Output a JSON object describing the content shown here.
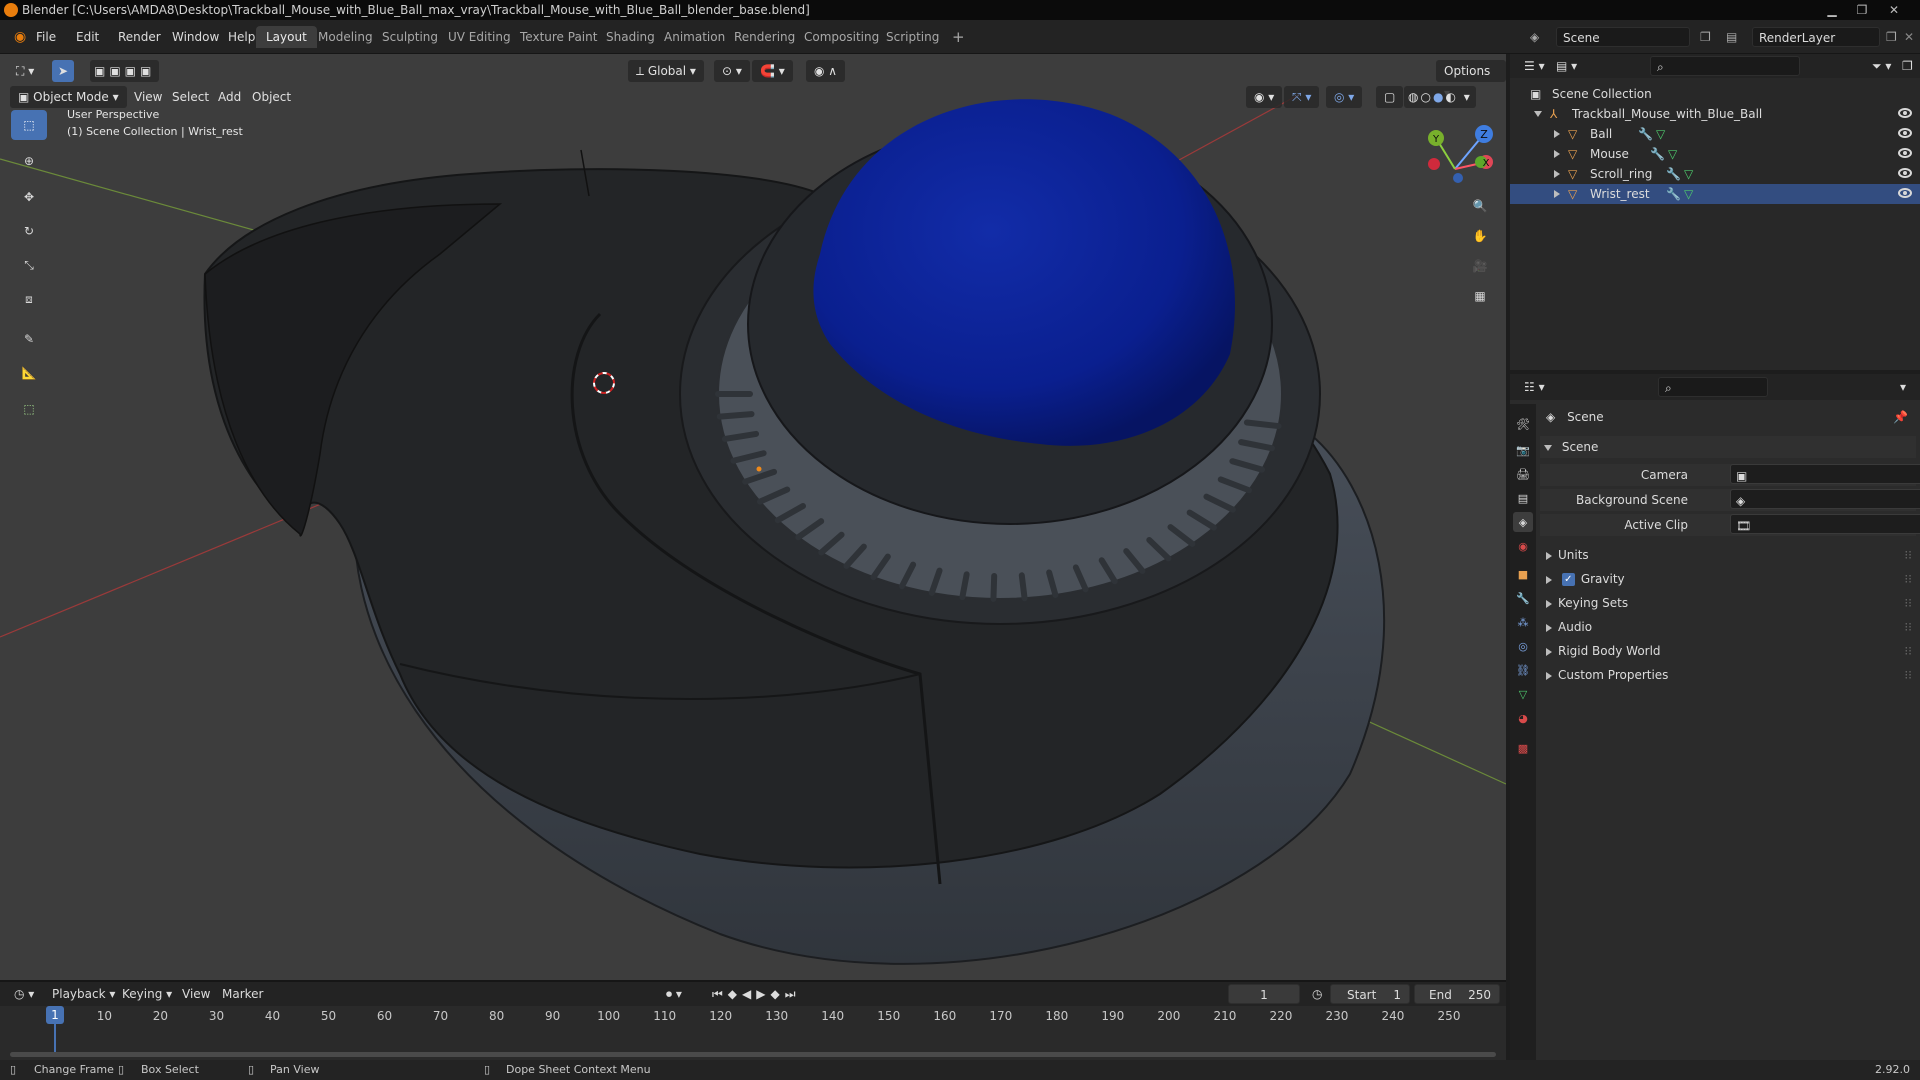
{
  "window": {
    "title": "Blender [C:\\Users\\AMDA8\\Desktop\\Trackball_Mouse_with_Blue_Ball_max_vray\\Trackball_Mouse_with_Blue_Ball_blender_base.blend]"
  },
  "menu": {
    "items": [
      "File",
      "Edit",
      "Render",
      "Window",
      "Help"
    ]
  },
  "workspaces": {
    "tabs": [
      "Layout",
      "Modeling",
      "Sculpting",
      "UV Editing",
      "Texture Paint",
      "Shading",
      "Animation",
      "Rendering",
      "Compositing",
      "Scripting"
    ],
    "active": "Layout"
  },
  "top_right": {
    "scene_field": "Scene",
    "render_layer_field": "RenderLayer"
  },
  "viewport_header": {
    "transform_orientation": "Global",
    "options_label": "Options",
    "mode": "Object Mode",
    "menus": [
      "View",
      "Select",
      "Add",
      "Object"
    ]
  },
  "viewport": {
    "perspective_label": "User Perspective",
    "collection_label": "(1) Scene Collection | Wrist_rest",
    "ball_color": "#0a1f8f",
    "body_color": "#232527",
    "ring_color": "#3a4049",
    "accent_color": "#4772b3",
    "gizmo": {
      "x": "X",
      "y": "Y",
      "z": "Z"
    }
  },
  "timeline": {
    "menus": [
      "Playback",
      "Keying",
      "View",
      "Marker"
    ],
    "current_frame": "1",
    "start_label": "Start",
    "start_value": "1",
    "end_label": "End",
    "end_value": "250",
    "ticks": [
      "1",
      "10",
      "20",
      "30",
      "40",
      "50",
      "60",
      "70",
      "80",
      "90",
      "100",
      "110",
      "120",
      "130",
      "140",
      "150",
      "160",
      "170",
      "180",
      "190",
      "200",
      "210",
      "220",
      "230",
      "240",
      "250"
    ]
  },
  "status_bar": {
    "hints": [
      "Change Frame",
      "Box Select",
      "Pan View",
      "Dope Sheet Context Menu"
    ],
    "version": "2.92.0"
  },
  "outliner": {
    "root": "Scene Collection",
    "collection": "Trackball_Mouse_with_Blue_Ball",
    "objects": [
      "Ball",
      "Mouse",
      "Scroll_ring",
      "Wrist_rest"
    ]
  },
  "properties": {
    "context": "Scene",
    "panel_title": "Scene",
    "fields": [
      {
        "label": "Camera"
      },
      {
        "label": "Background Scene"
      },
      {
        "label": "Active Clip"
      }
    ],
    "panels": [
      "Units",
      "Gravity",
      "Keying Sets",
      "Audio",
      "Rigid Body World",
      "Custom Properties"
    ],
    "gravity_checked": true
  }
}
